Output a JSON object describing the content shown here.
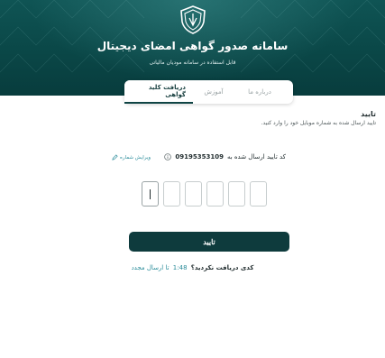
{
  "header": {
    "title": "سامانه صدور گواهی امضای دیجیتال",
    "subtitle": "قابل استفاده در سامانه مودیان مالیاتی"
  },
  "tabs": [
    {
      "label": "دریافت کلید گواهی",
      "active": true
    },
    {
      "label": "آموزش",
      "active": false
    },
    {
      "label": "درباره ما",
      "active": false
    }
  ],
  "verify": {
    "title": "تایید",
    "description": "تایید ارسال شده به شماره موبایل خود را وارد کنید.",
    "phone_label": "کد تایید ارسال شده به",
    "phone_number": "09195353109",
    "edit_label": "ویرایش شماره",
    "otp_digits": [
      "",
      "",
      "",
      "",
      "",
      ""
    ],
    "confirm_label": "تایید",
    "resend_question": "کدی دریافت نکردید؟",
    "resend_timer": "1:48",
    "resend_link": "تا ارسال مجدد"
  },
  "colors": {
    "header_bg": "#0b4a4a",
    "button_bg": "#0e3b3d",
    "link": "#2a8c9a"
  }
}
